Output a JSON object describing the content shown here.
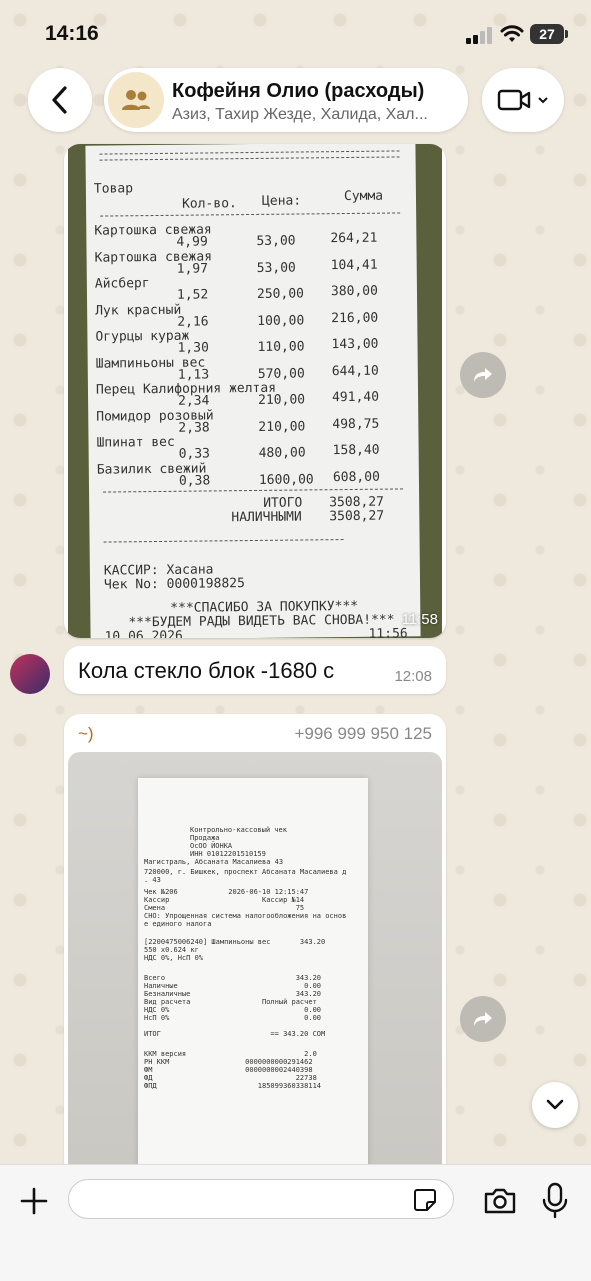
{
  "status_bar": {
    "time": "14:16",
    "battery": "27"
  },
  "header": {
    "title": "Кофейня Олио (расходы)",
    "subtitle": "Азиз, Тахир Жезде, Халида, Хал..."
  },
  "receipt1": {
    "header_cols": [
      "Товар",
      "Кол-во.",
      "Цена:",
      "Сумма"
    ],
    "items": [
      {
        "name": "Картошка свежая",
        "qty": "4,99",
        "price": "53,00",
        "sum": "264,21"
      },
      {
        "name": "Картошка свежая",
        "qty": "1,97",
        "price": "53,00",
        "sum": "104,41"
      },
      {
        "name": "Айсберг",
        "qty": "1,52",
        "price": "250,00",
        "sum": "380,00"
      },
      {
        "name": "Лук красный",
        "qty": "2,16",
        "price": "100,00",
        "sum": "216,00"
      },
      {
        "name": "Огурцы кураж",
        "qty": "1,30",
        "price": "110,00",
        "sum": "143,00"
      },
      {
        "name": "Шампиньоны вес",
        "qty": "1,13",
        "price": "570,00",
        "sum": "644,10"
      },
      {
        "name": "Перец Калифорния желтая",
        "qty": "2,34",
        "price": "210,00",
        "sum": "491,40"
      },
      {
        "name": "Помидор розовый",
        "qty": "2,38",
        "price": "210,00",
        "sum": "498,75"
      },
      {
        "name": "Шпинат вес",
        "qty": "0,33",
        "price": "480,00",
        "sum": "158,40"
      },
      {
        "name": "Базилик свежий",
        "qty": "0,38",
        "price": "1600,00",
        "sum": "608,00"
      }
    ],
    "total_label": "ИТОГО",
    "total": "3508,27",
    "cash_label": "НАЛИЧНЫМИ",
    "cash": "3508,27",
    "cashier": "КАССИР: Хасана",
    "check_no": "Чек No: 0000198825",
    "thanks": "***СПАСИБО ЗА ПОКУПКУ***",
    "see_again": "***БУДЕМ РАДЫ ВИДЕТЬ ВАС СНОВА!***",
    "date": "10.06.2026",
    "print_time": "11:56",
    "timestamp": "11:58"
  },
  "text_message": {
    "text": "Кола стекло блок -1680 с",
    "timestamp": "12:08"
  },
  "photo_message": {
    "sender": "~)",
    "phone": "+996 999 950 125",
    "receipt_lines": [
      "Контрольно-кассовый чек",
      "Продажа",
      "ОсОО ЙОНКА",
      "ИНН 01012201510159",
      "Магистраль, Абсаната Масалиева 43",
      "720000, г. Бишкек, проспект Абсаната Масалиева д",
      ". 43",
      "Чек №206            2026-06-10 12:15:47",
      "Кассир                      Кассир №14",
      "Смена                               75",
      "СНО: Упрощенная система налогообложения на основ",
      "е единого налога",
      "[2200475006240] Шампиньоны вес       343.20",
      "550 x0.624 кг",
      "НДС 0%, НсП 0%",
      "Всего                               343.20",
      "Наличные                              0.00",
      "Безналичные                         343.20",
      "Вид расчета                 Полный расчет",
      "НДС 0%                                0.00",
      "НсП 0%                                0.00",
      "ИТОГ                          == 343.20 СОМ",
      "ККМ версия                            2.0",
      "РН ККМ                  0000000000291462",
      "ФМ                      0000000002440398",
      "ФД                                  22738",
      "ФПД                        185099360338114"
    ]
  },
  "input": {
    "placeholder": ""
  }
}
